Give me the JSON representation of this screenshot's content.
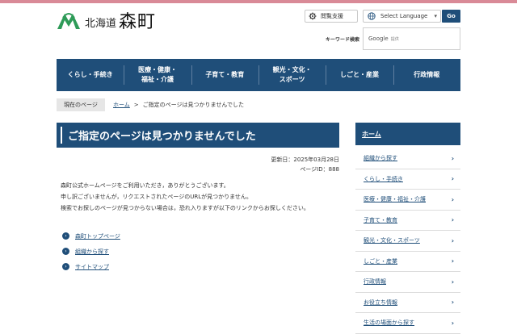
{
  "header": {
    "pref": "北海道",
    "town": "森町",
    "reading_support": "閲覧支援",
    "select_language": "Select Language",
    "go": "Go",
    "keyword_label": "キーワード検索",
    "search_google": "Google",
    "search_sub": "提供"
  },
  "nav": [
    "くらし・手続き",
    "医療・健康・\n福祉・介護",
    "子育て・教育",
    "観光・文化・\nスポーツ",
    "しごと・産業",
    "行政情報"
  ],
  "breadcrumb": {
    "tag": "現在のページ",
    "home": "ホーム",
    "current": "ご指定のページは見つかりませんでした"
  },
  "main": {
    "title": "ご指定のページは見つかりませんでした",
    "updated": "更新日：2025年03月28日",
    "page_id": "ページID：888",
    "paragraph_1": "森町公式ホームページをご利用いただき，ありがとうございます。",
    "paragraph_2": "申し訳ございませんが，リクエストされたページのURLが見つかりません。",
    "paragraph_3": "検索でお探しのページが見つからない場合は，恐れ入りますが以下のリンクからお探しください。",
    "links": [
      "森町トップページ",
      "組織から探す",
      "サイトマップ"
    ]
  },
  "sidebar": {
    "heading": "ホーム",
    "items": [
      "組織から探す",
      "くらし・手続き",
      "医療・健康・福祉・介護",
      "子育て・教育",
      "観光・文化・スポーツ",
      "しごと・産業",
      "行政情報",
      "お役立ち情報",
      "生活の場面から探す"
    ]
  },
  "colors": {
    "brand": "#1f4e79",
    "accent_bar": "#d98a97",
    "logo_green": "#2e9b58"
  }
}
